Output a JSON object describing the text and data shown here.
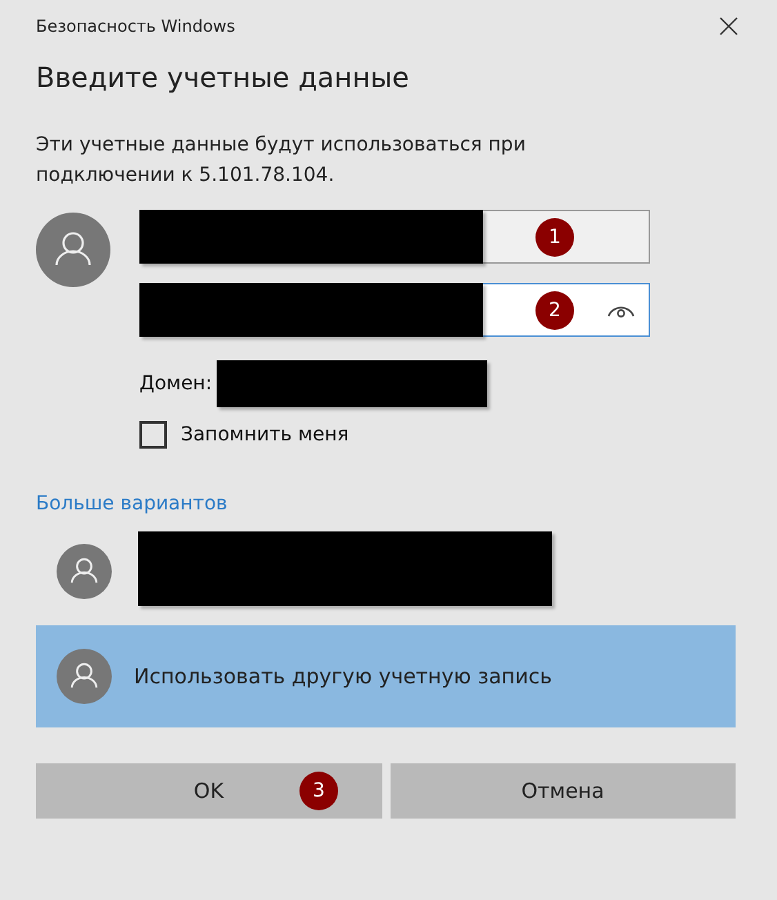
{
  "window": {
    "title": "Безопасность Windows"
  },
  "heading": "Введите учетные данные",
  "description": "Эти учетные данные будут использоваться при подключении к 5.101.78.104.",
  "fields": [
    {
      "kind": "username",
      "focused": false,
      "redacted": true,
      "marker": "1"
    },
    {
      "kind": "password",
      "focused": true,
      "redacted": true,
      "marker": "2"
    }
  ],
  "domain": {
    "label": "Домен:",
    "redacted": true
  },
  "remember": {
    "label": "Запомнить меня",
    "checked": false
  },
  "more_options": "Больше вариантов",
  "accounts": [
    {
      "kind": "redacted",
      "selected": false
    },
    {
      "kind": "text",
      "label": "Использовать другую учетную запись",
      "selected": true
    }
  ],
  "buttons": [
    {
      "label": "OK",
      "marker": "3"
    },
    {
      "label": "Отмена"
    }
  ]
}
